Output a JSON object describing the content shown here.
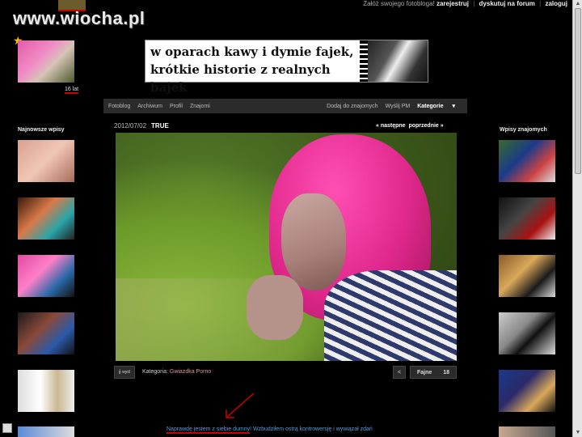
{
  "site": {
    "watermark": "www.wiocha.pl"
  },
  "topbar": {
    "prompt": "Załóż swojego fotobloga!",
    "register": "zarejestruj",
    "forum": "dyskutuj na forum",
    "login": "zaloguj"
  },
  "profile": {
    "age": "16 lat"
  },
  "banner": {
    "line1": "w oparach kawy i dymie fajek,",
    "line2": "krótkie historie z realnych bajek"
  },
  "nav": {
    "fotoblog": "Fotoblog",
    "archiwum": "Archiwum",
    "profil": "Profil",
    "znajomi": "Znajomi",
    "dodaj": "Dodaj do znajomych",
    "wyslij": "Wyślij PM",
    "kategorie": "Kategorie"
  },
  "post": {
    "date": "2012/07/02",
    "title": "TRUE",
    "next": "« następne",
    "prev": "poprzednie »",
    "kategoria_label": "Kategoria:",
    "kategoria_value": "Gwiazdka Porno",
    "like_label": "Fajne",
    "like_count": "18",
    "ikona_label": "i",
    "ikona_sub": "wyśl"
  },
  "comment": {
    "first": "Naprawdę jestem z siebie dumny",
    "rest": "! Wzbudziłem ostrą kontrowersję i wywiązał zdań"
  },
  "sidebars": {
    "left_title": "Najnowsze wpisy",
    "right_title": "Wpisy znajomych"
  },
  "colors": {
    "accent_red": "#cc0000",
    "hair_pink": "#e0288c",
    "link_blue": "#5a9ad8"
  }
}
